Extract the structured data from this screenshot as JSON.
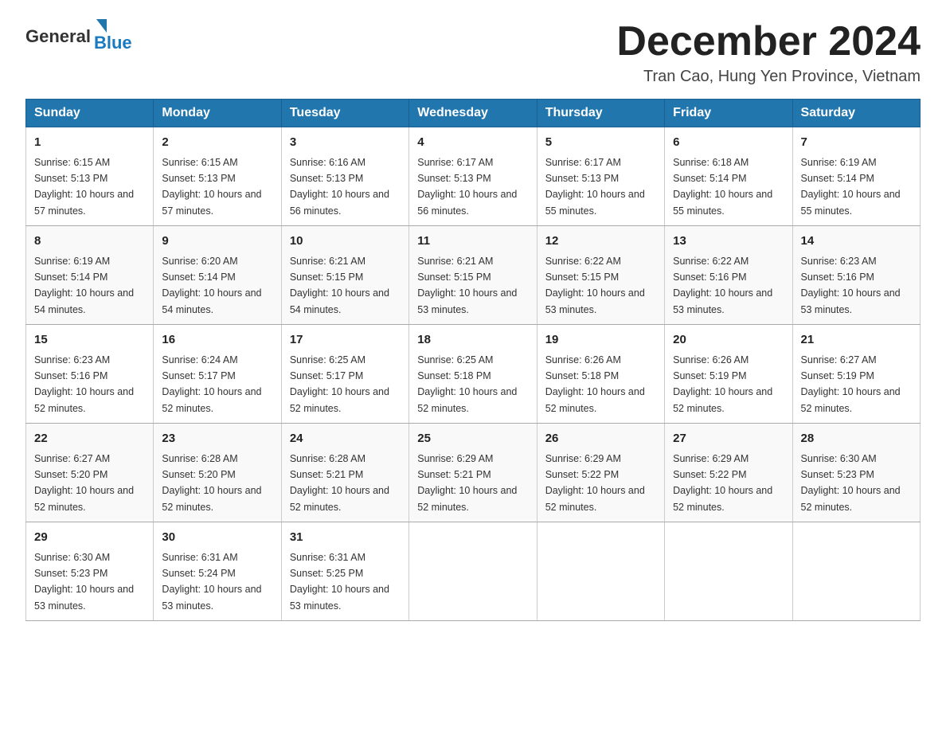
{
  "header": {
    "logo_general": "General",
    "logo_blue": "Blue",
    "month_title": "December 2024",
    "location": "Tran Cao, Hung Yen Province, Vietnam"
  },
  "weekdays": [
    "Sunday",
    "Monday",
    "Tuesday",
    "Wednesday",
    "Thursday",
    "Friday",
    "Saturday"
  ],
  "weeks": [
    [
      {
        "day": "1",
        "sunrise": "6:15 AM",
        "sunset": "5:13 PM",
        "daylight": "10 hours and 57 minutes."
      },
      {
        "day": "2",
        "sunrise": "6:15 AM",
        "sunset": "5:13 PM",
        "daylight": "10 hours and 57 minutes."
      },
      {
        "day": "3",
        "sunrise": "6:16 AM",
        "sunset": "5:13 PM",
        "daylight": "10 hours and 56 minutes."
      },
      {
        "day": "4",
        "sunrise": "6:17 AM",
        "sunset": "5:13 PM",
        "daylight": "10 hours and 56 minutes."
      },
      {
        "day": "5",
        "sunrise": "6:17 AM",
        "sunset": "5:13 PM",
        "daylight": "10 hours and 55 minutes."
      },
      {
        "day": "6",
        "sunrise": "6:18 AM",
        "sunset": "5:14 PM",
        "daylight": "10 hours and 55 minutes."
      },
      {
        "day": "7",
        "sunrise": "6:19 AM",
        "sunset": "5:14 PM",
        "daylight": "10 hours and 55 minutes."
      }
    ],
    [
      {
        "day": "8",
        "sunrise": "6:19 AM",
        "sunset": "5:14 PM",
        "daylight": "10 hours and 54 minutes."
      },
      {
        "day": "9",
        "sunrise": "6:20 AM",
        "sunset": "5:14 PM",
        "daylight": "10 hours and 54 minutes."
      },
      {
        "day": "10",
        "sunrise": "6:21 AM",
        "sunset": "5:15 PM",
        "daylight": "10 hours and 54 minutes."
      },
      {
        "day": "11",
        "sunrise": "6:21 AM",
        "sunset": "5:15 PM",
        "daylight": "10 hours and 53 minutes."
      },
      {
        "day": "12",
        "sunrise": "6:22 AM",
        "sunset": "5:15 PM",
        "daylight": "10 hours and 53 minutes."
      },
      {
        "day": "13",
        "sunrise": "6:22 AM",
        "sunset": "5:16 PM",
        "daylight": "10 hours and 53 minutes."
      },
      {
        "day": "14",
        "sunrise": "6:23 AM",
        "sunset": "5:16 PM",
        "daylight": "10 hours and 53 minutes."
      }
    ],
    [
      {
        "day": "15",
        "sunrise": "6:23 AM",
        "sunset": "5:16 PM",
        "daylight": "10 hours and 52 minutes."
      },
      {
        "day": "16",
        "sunrise": "6:24 AM",
        "sunset": "5:17 PM",
        "daylight": "10 hours and 52 minutes."
      },
      {
        "day": "17",
        "sunrise": "6:25 AM",
        "sunset": "5:17 PM",
        "daylight": "10 hours and 52 minutes."
      },
      {
        "day": "18",
        "sunrise": "6:25 AM",
        "sunset": "5:18 PM",
        "daylight": "10 hours and 52 minutes."
      },
      {
        "day": "19",
        "sunrise": "6:26 AM",
        "sunset": "5:18 PM",
        "daylight": "10 hours and 52 minutes."
      },
      {
        "day": "20",
        "sunrise": "6:26 AM",
        "sunset": "5:19 PM",
        "daylight": "10 hours and 52 minutes."
      },
      {
        "day": "21",
        "sunrise": "6:27 AM",
        "sunset": "5:19 PM",
        "daylight": "10 hours and 52 minutes."
      }
    ],
    [
      {
        "day": "22",
        "sunrise": "6:27 AM",
        "sunset": "5:20 PM",
        "daylight": "10 hours and 52 minutes."
      },
      {
        "day": "23",
        "sunrise": "6:28 AM",
        "sunset": "5:20 PM",
        "daylight": "10 hours and 52 minutes."
      },
      {
        "day": "24",
        "sunrise": "6:28 AM",
        "sunset": "5:21 PM",
        "daylight": "10 hours and 52 minutes."
      },
      {
        "day": "25",
        "sunrise": "6:29 AM",
        "sunset": "5:21 PM",
        "daylight": "10 hours and 52 minutes."
      },
      {
        "day": "26",
        "sunrise": "6:29 AM",
        "sunset": "5:22 PM",
        "daylight": "10 hours and 52 minutes."
      },
      {
        "day": "27",
        "sunrise": "6:29 AM",
        "sunset": "5:22 PM",
        "daylight": "10 hours and 52 minutes."
      },
      {
        "day": "28",
        "sunrise": "6:30 AM",
        "sunset": "5:23 PM",
        "daylight": "10 hours and 52 minutes."
      }
    ],
    [
      {
        "day": "29",
        "sunrise": "6:30 AM",
        "sunset": "5:23 PM",
        "daylight": "10 hours and 53 minutes."
      },
      {
        "day": "30",
        "sunrise": "6:31 AM",
        "sunset": "5:24 PM",
        "daylight": "10 hours and 53 minutes."
      },
      {
        "day": "31",
        "sunrise": "6:31 AM",
        "sunset": "5:25 PM",
        "daylight": "10 hours and 53 minutes."
      },
      null,
      null,
      null,
      null
    ]
  ]
}
